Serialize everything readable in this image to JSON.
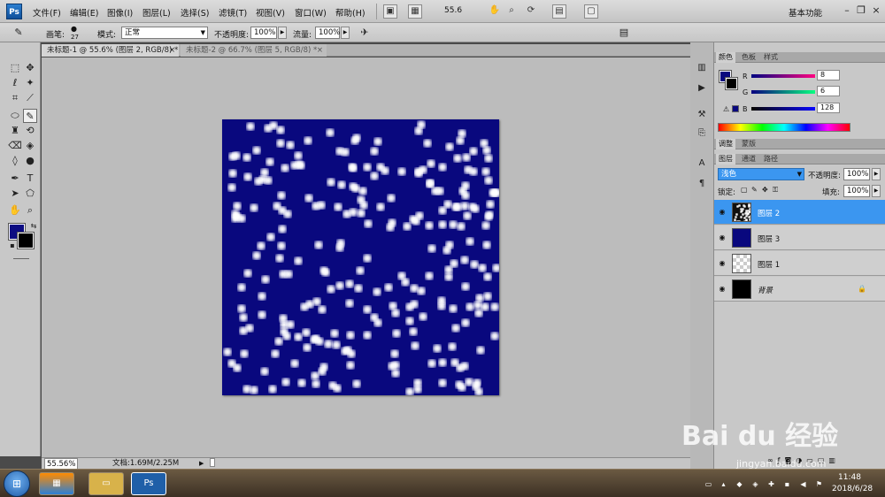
{
  "app": {
    "logo": "Ps",
    "menu": [
      "文件(F)",
      "编辑(E)",
      "图像(I)",
      "图层(L)",
      "选择(S)",
      "滤镜(T)",
      "视图(V)",
      "窗口(W)",
      "帮助(H)"
    ],
    "zoom_select": "55.6",
    "workspace": "基本功能"
  },
  "options_bar": {
    "brush_label": "画笔:",
    "brush_size": "27",
    "mode_label": "模式:",
    "mode_value": "正常",
    "opacity_label": "不透明度:",
    "opacity_value": "100%",
    "flow_label": "流量:",
    "flow_value": "100%"
  },
  "documents": {
    "tabs": [
      "未标题-1 @ 55.6% (图层 2, RGB/8) *",
      "未标题-2 @ 66.7% (图层 5, RGB/8) *"
    ],
    "close_glyph": "×"
  },
  "status": {
    "zoom": "55.56%",
    "doc_info": "文档:1.69M/2.25M"
  },
  "color_panel": {
    "tabs": [
      "颜色",
      "色板",
      "样式"
    ],
    "channels": [
      {
        "label": "R",
        "value": "8"
      },
      {
        "label": "G",
        "value": "6"
      },
      {
        "label": "B",
        "value": "128"
      }
    ]
  },
  "adjust_panel": {
    "tabs": [
      "调整",
      "蒙版"
    ]
  },
  "layers_panel": {
    "tabs": [
      "图层",
      "通道",
      "路径"
    ],
    "blend_mode": "浅色",
    "opacity_label": "不透明度:",
    "opacity_value": "100%",
    "lock_label": "锁定:",
    "fill_label": "填充:",
    "fill_value": "100%",
    "layers": [
      {
        "name": "图层 2",
        "thumb": "stars",
        "selected": true
      },
      {
        "name": "图层 3",
        "thumb": "blue",
        "selected": false
      },
      {
        "name": "图层 1",
        "thumb": "transparent",
        "selected": false
      },
      {
        "name": "背景",
        "thumb": "black",
        "selected": false,
        "locked": true
      }
    ]
  },
  "taskbar": {
    "time": "11:48",
    "date": "2018/6/28"
  },
  "watermark": {
    "text": "Bai du 经验",
    "sub": "jingyan.baidu.com"
  },
  "colors": {
    "canvas_blue": "#09087e",
    "foreground": "#0c0c82",
    "background": "#000000",
    "selection": "#3b96f0"
  }
}
